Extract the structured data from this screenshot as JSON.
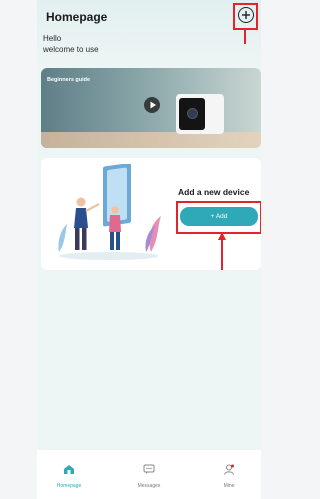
{
  "header": {
    "title": "Homepage",
    "hello": "Hello",
    "welcome": "welcome to use"
  },
  "banner": {
    "label": "Beginners guide"
  },
  "card": {
    "heading": "Add a new device",
    "add_button": "+ Add"
  },
  "tabbar": {
    "items": [
      {
        "label": "Homepage",
        "icon": "home-icon",
        "active": true
      },
      {
        "label": "Messages",
        "icon": "message-icon",
        "active": false
      },
      {
        "label": "Mine",
        "icon": "user-icon",
        "active": false
      }
    ]
  },
  "colors": {
    "accent": "#2fa8b8",
    "highlight_red": "#e0252b"
  }
}
